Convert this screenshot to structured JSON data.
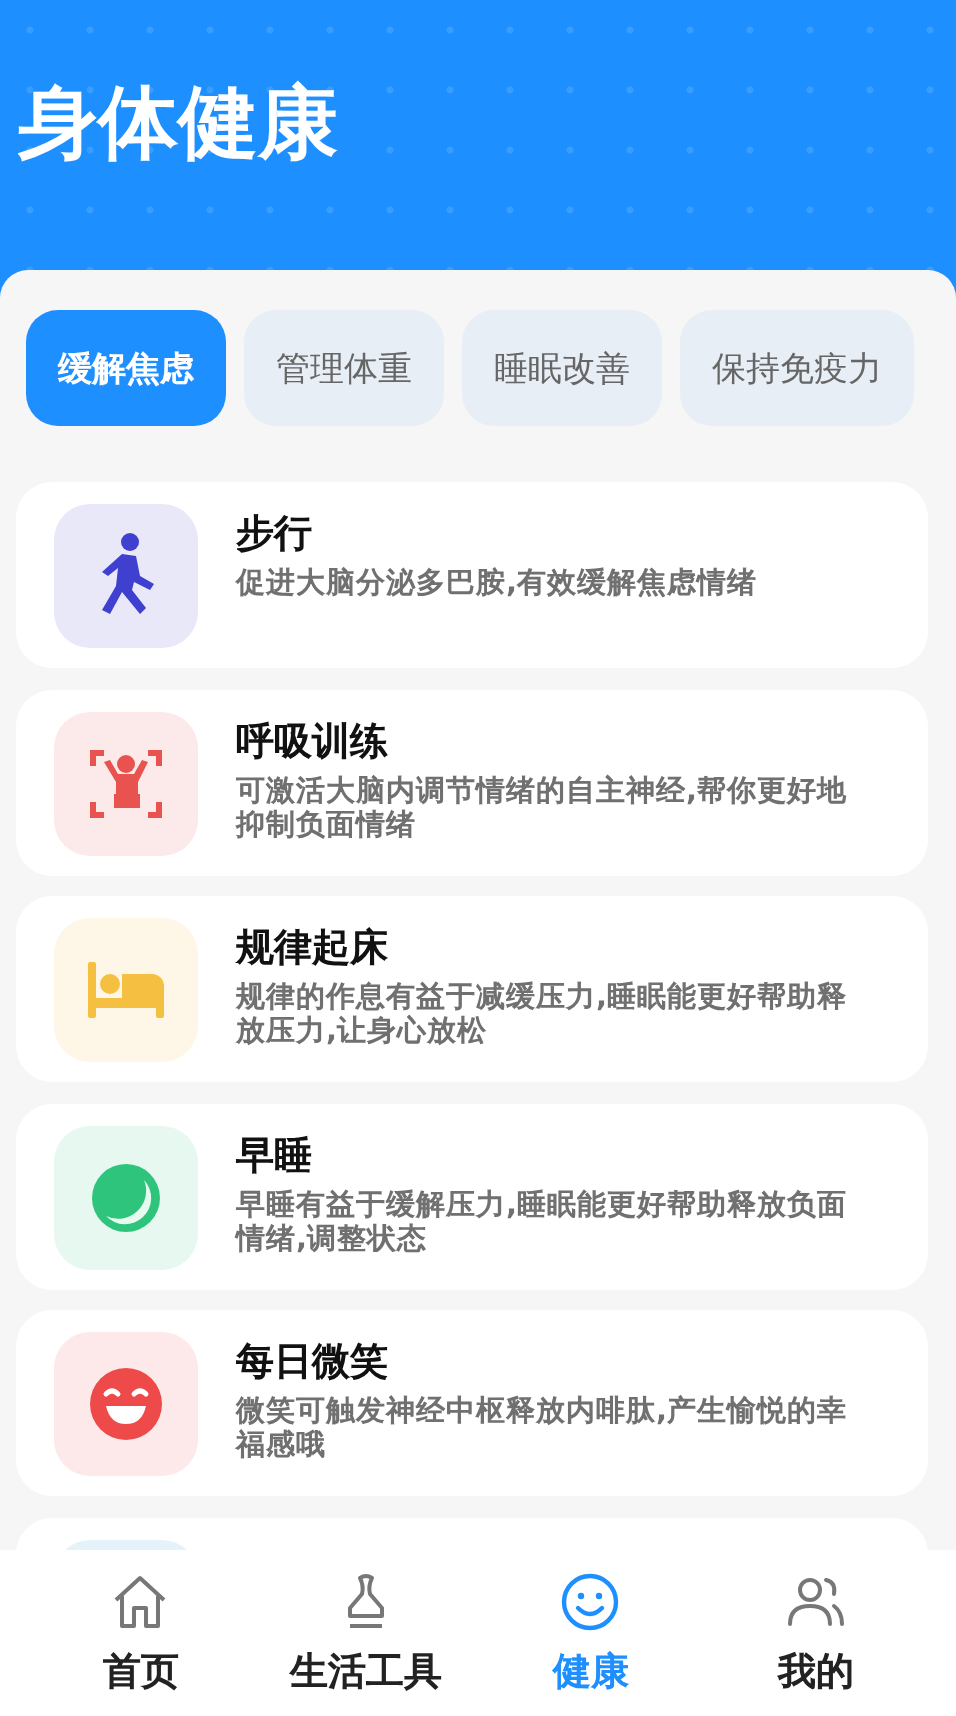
{
  "header": {
    "title": "身体健康"
  },
  "tabs": [
    {
      "label": "缓解焦虑",
      "selected": true
    },
    {
      "label": "管理体重",
      "selected": false
    },
    {
      "label": "睡眠改善",
      "selected": false
    },
    {
      "label": "保持免疫力",
      "selected": false
    }
  ],
  "items": [
    {
      "kind": "walk",
      "color": "#3f3fd0",
      "title": "步行",
      "desc": "促进大脑分泌多巴胺,有效缓解焦虑情绪"
    },
    {
      "kind": "breath",
      "color": "#e8534f",
      "title": "呼吸训练",
      "desc": "可激活大脑内调节情绪的自主神经,帮你更好地抑制负面情绪"
    },
    {
      "kind": "bed",
      "color": "#f5c042",
      "title": "规律起床",
      "desc": "规律的作息有益于减缓压力,睡眠能更好帮助释放压力,让身心放松"
    },
    {
      "kind": "moon",
      "color": "#2fc47c",
      "title": "早睡",
      "desc": "早睡有益于缓解压力,睡眠能更好帮助释放负面情绪,调整状态"
    },
    {
      "kind": "smile",
      "color": "#ee4a4a",
      "title": "每日微笑",
      "desc": "微笑可触发神经中枢释放内啡肽,产生愉悦的幸福感哦"
    },
    {
      "kind": "partial",
      "color": "#e4f3fa"
    }
  ],
  "nav": [
    {
      "kind": "home",
      "label": "首页",
      "selected": false
    },
    {
      "kind": "tools",
      "label": "生活工具",
      "selected": false
    },
    {
      "kind": "health",
      "label": "健康",
      "selected": true
    },
    {
      "kind": "mine",
      "label": "我的",
      "selected": false
    }
  ]
}
